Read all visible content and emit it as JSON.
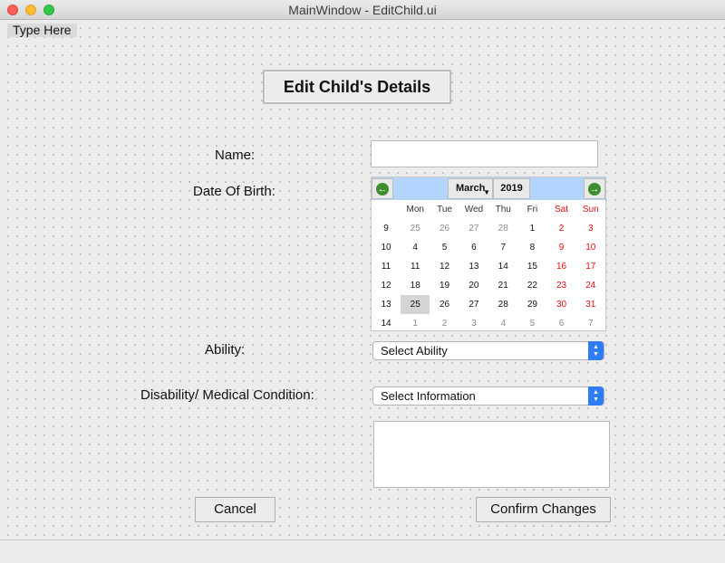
{
  "window": {
    "title": "MainWindow - EditChild.ui"
  },
  "menubar": {
    "item": "Type Here"
  },
  "form": {
    "heading": "Edit Child's Details",
    "name_label": "Name:",
    "name_value": "",
    "dob_label": "Date Of Birth:",
    "ability_label": "Ability:",
    "ability_select": "Select Ability",
    "disability_label": "Disability/ Medical Condition:",
    "disability_select": "Select Information",
    "info_text": "",
    "cancel_label": "Cancel",
    "confirm_label": "Confirm Changes"
  },
  "calendar": {
    "month": "March",
    "year": "2019",
    "weekdays": [
      "Mon",
      "Tue",
      "Wed",
      "Thu",
      "Fri",
      "Sat",
      "Sun"
    ],
    "weeks": [
      {
        "num": "9",
        "days": [
          "25",
          "26",
          "27",
          "28",
          "1",
          "2",
          "3"
        ]
      },
      {
        "num": "10",
        "days": [
          "4",
          "5",
          "6",
          "7",
          "8",
          "9",
          "10"
        ]
      },
      {
        "num": "11",
        "days": [
          "11",
          "12",
          "13",
          "14",
          "15",
          "16",
          "17"
        ]
      },
      {
        "num": "12",
        "days": [
          "18",
          "19",
          "20",
          "21",
          "22",
          "23",
          "24"
        ]
      },
      {
        "num": "13",
        "days": [
          "25",
          "26",
          "27",
          "28",
          "29",
          "30",
          "31"
        ]
      },
      {
        "num": "14",
        "days": [
          "1",
          "2",
          "3",
          "4",
          "5",
          "6",
          "7"
        ]
      }
    ],
    "selected_date": "25"
  },
  "icons": {
    "prev": "arrow-left-circle-icon",
    "next": "arrow-right-circle-icon",
    "select": "chevron-up-down-icon"
  },
  "colors": {
    "weekend": "#e21010",
    "nav_bar": "#b3d5fd",
    "nav_icon": "#3f8e2e",
    "select_accent": "#2f7df6"
  }
}
